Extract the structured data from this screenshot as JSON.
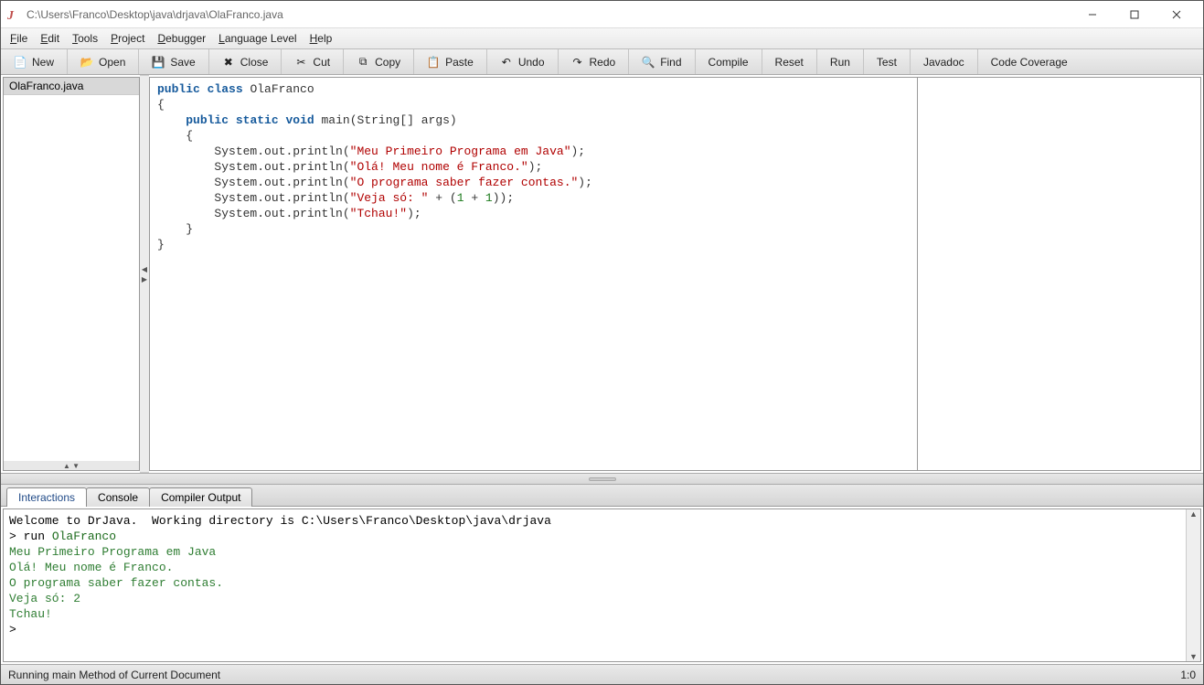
{
  "title": "C:\\Users\\Franco\\Desktop\\java\\drjava\\OlaFranco.java",
  "menus": {
    "file": "File",
    "edit": "Edit",
    "tools": "Tools",
    "project": "Project",
    "debugger": "Debugger",
    "lang": "Language Level",
    "help": "Help"
  },
  "toolbar": {
    "new": "New",
    "open": "Open",
    "save": "Save",
    "close": "Close",
    "cut": "Cut",
    "copy": "Copy",
    "paste": "Paste",
    "undo": "Undo",
    "redo": "Redo",
    "find": "Find",
    "compile": "Compile",
    "reset": "Reset",
    "run": "Run",
    "test": "Test",
    "javadoc": "Javadoc",
    "coverage": "Code Coverage"
  },
  "files": {
    "item0": "OlaFranco.java"
  },
  "code": {
    "kw_public": "public",
    "kw_class": "class",
    "cname": "OlaFranco",
    "kw_static": "static",
    "kw_void": "void",
    "main": "main",
    "args": "(String[] args)",
    "sys": "System",
    "out": ".out.println(",
    "s1": "\"Meu Primeiro Programa em Java\"",
    "e1": ");",
    "s2": "\"Olá! Meu nome é Franco.\"",
    "e2": ");",
    "s3": "\"O programa saber fazer contas.\"",
    "e3": ");",
    "s4": "\"Veja só: \"",
    "plus": " + (",
    "n1": "1",
    "mid": " + ",
    "n2": "1",
    "e4": "));",
    "s5": "\"Tchau!\"",
    "e5": ");",
    "ob": "{",
    "cb": "}"
  },
  "tabs": {
    "interactions": "Interactions",
    "console": "Console",
    "compiler": "Compiler Output"
  },
  "consoleOut": {
    "welcome": "Welcome to DrJava.  Working directory is C:\\Users\\Franco\\Desktop\\java\\drjava",
    "prompt1": "> ",
    "run": "run ",
    "name": "OlaFranco",
    "l1": "Meu Primeiro Programa em Java",
    "l2": "Olá! Meu nome é Franco.",
    "l3": "O programa saber fazer contas.",
    "l4": "Veja só: 2",
    "l5": "Tchau!",
    "prompt2": "> "
  },
  "status": {
    "msg": "Running main Method of Current Document",
    "pos": "1:0"
  }
}
